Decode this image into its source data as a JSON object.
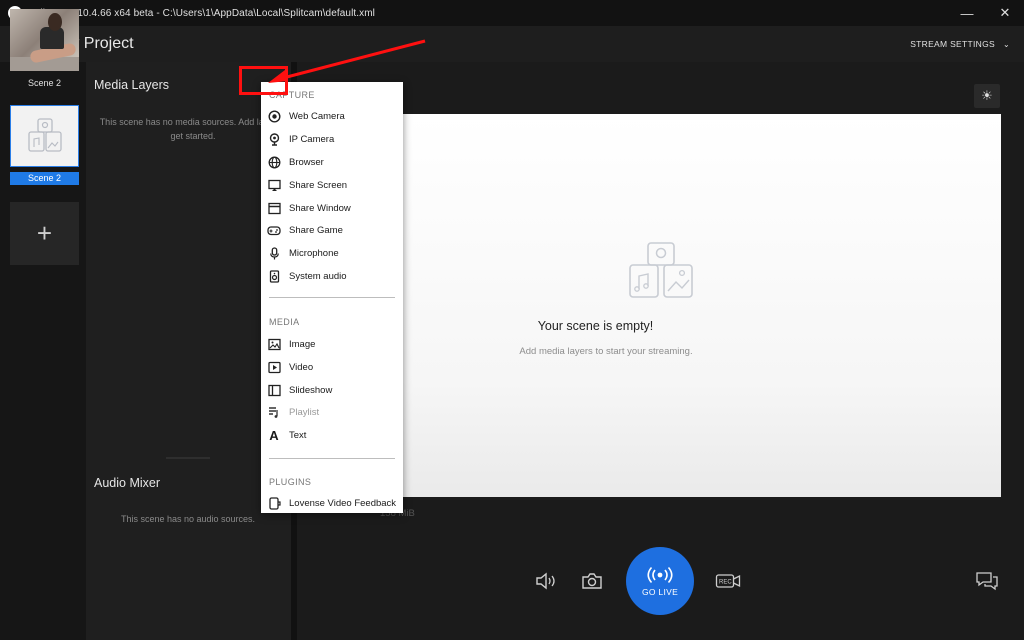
{
  "window": {
    "title": "SplitCam v10.4.66 x64 beta - C:\\Users\\1\\AppData\\Local\\Splitcam\\default.xml",
    "minimize_icon": "minimize-icon",
    "close_icon": "close-icon"
  },
  "header": {
    "project_title": "My Project",
    "stream_settings": "STREAM SETTINGS"
  },
  "scenes": {
    "items": [
      {
        "label": "Scene 2",
        "selected": false
      },
      {
        "label": "Scene 2",
        "selected": true
      }
    ],
    "add_label": "+"
  },
  "layers": {
    "title": "Media Layers",
    "empty_text": "This scene has no media sources. Add layer to get started."
  },
  "audio": {
    "title": "Audio Mixer",
    "empty_text": "This scene has no audio sources."
  },
  "preview": {
    "empty_title": "Your scene is empty!",
    "empty_subtitle": "Add media layers to start your streaming.",
    "stats": "158 MiB"
  },
  "toolbar": {
    "go_live": "GO LIVE",
    "go_live_color": "#1e6fe0"
  },
  "menu": {
    "sections": {
      "capture": "CAPTURE",
      "media": "MEDIA",
      "plugins": "PLUGINS"
    },
    "capture_items": [
      {
        "label": "Web Camera",
        "icon": "webcam-icon"
      },
      {
        "label": "IP Camera",
        "icon": "ip-camera-icon"
      },
      {
        "label": "Browser",
        "icon": "globe-icon"
      },
      {
        "label": "Share Screen",
        "icon": "monitor-icon"
      },
      {
        "label": "Share Window",
        "icon": "window-icon"
      },
      {
        "label": "Share Game",
        "icon": "gamepad-icon"
      },
      {
        "label": "Microphone",
        "icon": "microphone-icon"
      },
      {
        "label": "System audio",
        "icon": "speaker-icon"
      }
    ],
    "media_items": [
      {
        "label": "Image",
        "icon": "image-icon"
      },
      {
        "label": "Video",
        "icon": "video-icon"
      },
      {
        "label": "Slideshow",
        "icon": "slideshow-icon"
      },
      {
        "label": "Playlist",
        "icon": "playlist-icon",
        "disabled": true
      },
      {
        "label": "Text",
        "icon": "text-icon"
      }
    ],
    "plugin_items": [
      {
        "label": "Lovense Video Feedback",
        "icon": "plugin-icon"
      }
    ]
  },
  "annotation_color": "#ff1010"
}
